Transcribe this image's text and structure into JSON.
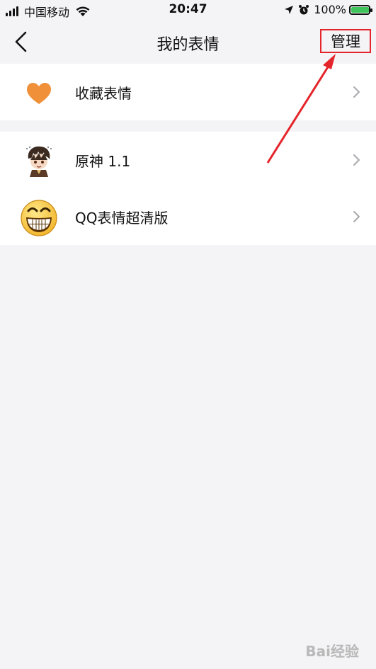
{
  "status_bar": {
    "carrier": "中国移动",
    "time": "20:47",
    "battery_percent": "100%",
    "battery_level": 1.0
  },
  "navbar": {
    "title": "我的表情",
    "manage_label": "管理"
  },
  "favorites": {
    "label": "收藏表情",
    "icon": "heart-icon"
  },
  "packs": [
    {
      "label": "原神 1.1",
      "icon": "genshin-sticker-icon"
    },
    {
      "label": "QQ表情超清版",
      "icon": "grin-emoji-icon"
    }
  ],
  "colors": {
    "accent_red": "#e4252b",
    "heart": "#f0913a",
    "battery_green": "#3ec45a"
  },
  "watermark": "Bai经验"
}
